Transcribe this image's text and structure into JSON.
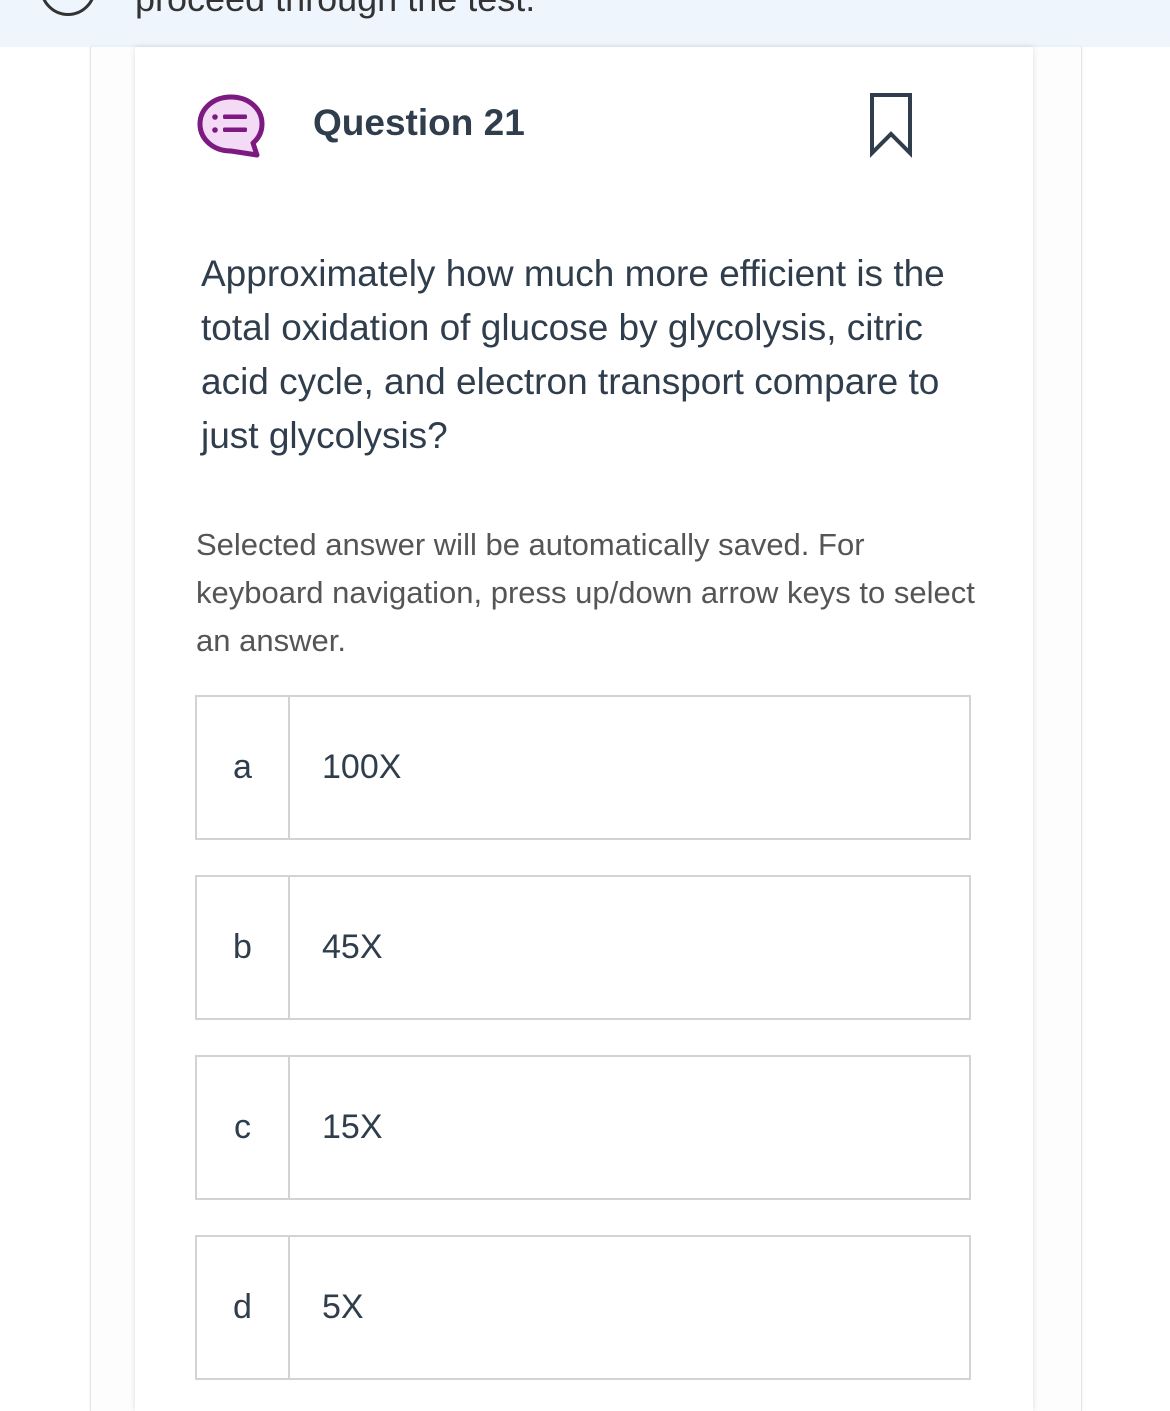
{
  "banner": {
    "text": "proceed through the test."
  },
  "question": {
    "title": "Question 21",
    "text": "Approximately how much more efficient is the total oxidation of glucose by glycolysis, citric acid cycle, and electron transport compare to just glycolysis?",
    "instruction": "Selected answer will be automatically saved. For keyboard navigation, press up/down arrow keys to select an answer."
  },
  "options": [
    {
      "letter": "a",
      "text": "100X"
    },
    {
      "letter": "b",
      "text": "45X"
    },
    {
      "letter": "c",
      "text": "15X"
    },
    {
      "letter": "d",
      "text": "5X"
    }
  ],
  "colors": {
    "accent": "#7d1a82",
    "icon_fill": "#f3dbf5",
    "title": "#2f3d4c",
    "border": "#d3d3d3",
    "banner_bg": "#eef5fd"
  },
  "icons": {
    "question_type": "question-bubble-icon",
    "bookmark": "bookmark-icon"
  }
}
